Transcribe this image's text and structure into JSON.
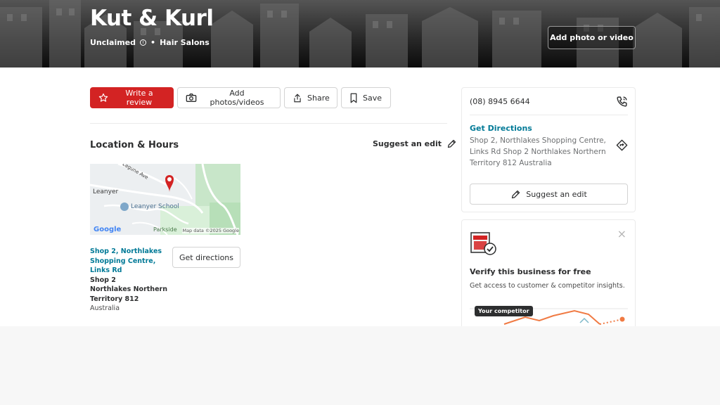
{
  "business": {
    "name": "Kut & Kurl",
    "claim_status": "Unclaimed",
    "info_icon": "info-icon",
    "category": "Hair Salons"
  },
  "hero": {
    "add_photo_label": "Add photo or video"
  },
  "actions": {
    "write_review": "Write a review",
    "add_photos": "Add photos/videos",
    "share": "Share",
    "save": "Save"
  },
  "location": {
    "title": "Location & Hours",
    "suggest_edit": "Suggest an edit",
    "map": {
      "street_label": "Lagune Ave",
      "suburb_label": "Leanyer",
      "school_label": "Leanyer School",
      "park_label": "Parkside",
      "google_label": "Google",
      "attribution": "Map data ©2025 Google"
    },
    "address_link": "Shop 2, Northlakes Shopping Centre, Links Rd",
    "address_line2": "Shop 2",
    "address_line3": "Northlakes Northern Territory 812",
    "country": "Australia",
    "get_directions_button": "Get directions"
  },
  "sidebar": {
    "phone": "(08) 8945 6644",
    "directions_label": "Get Directions",
    "directions_address": "Shop 2, Northlakes Shopping Centre, Links Rd Shop 2 Northlakes Northern Territory 812 Australia",
    "suggest_edit_button": "Suggest an edit"
  },
  "verify": {
    "title": "Verify this business for free",
    "subtitle": "Get access to customer & competitor insights.",
    "competitor_tag": "Your competitor"
  },
  "colors": {
    "brand_red": "#d32323",
    "link_teal": "#027a97"
  }
}
